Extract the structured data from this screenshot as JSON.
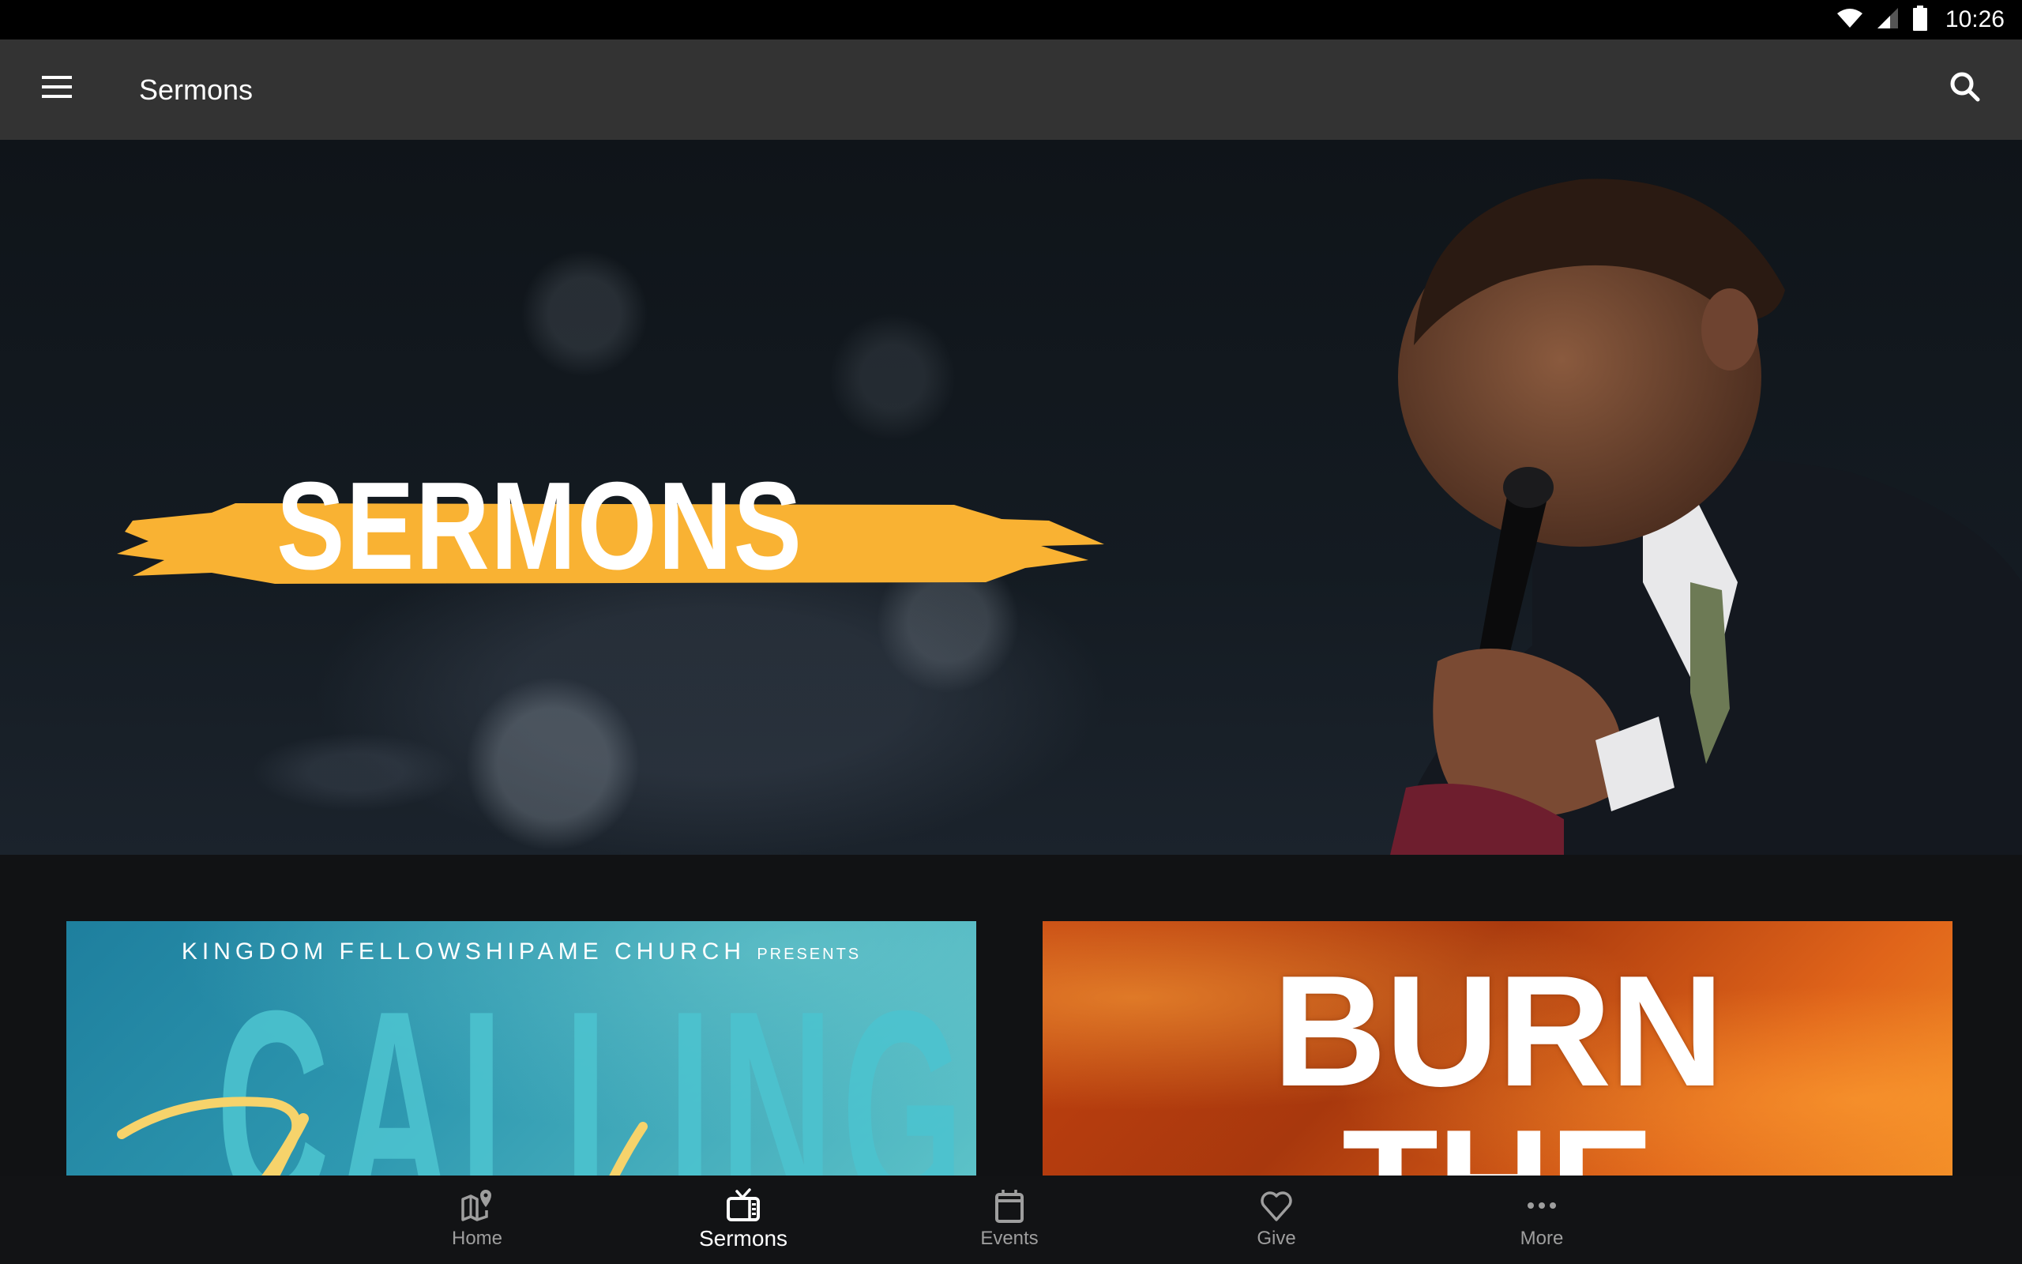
{
  "status_bar": {
    "time": "10:26",
    "icons": [
      "wifi-icon",
      "signal-icon",
      "battery-icon"
    ]
  },
  "app_bar": {
    "title": "Sermons",
    "menu_icon": "hamburger-menu-icon",
    "search_icon": "search-icon"
  },
  "hero": {
    "title": "SERMONS",
    "accent_color": "#F9B233"
  },
  "cards": [
    {
      "presenter": "KINGDOM FELLOWSHIPAME CHURCH",
      "presents": "PRESENTS",
      "title": "CALLING",
      "script_text": "You"
    },
    {
      "title_line1": "BURN",
      "title_line2": "THE"
    }
  ],
  "bottom_nav": {
    "items": [
      {
        "label": "Home",
        "icon": "map-pin-icon",
        "active": false
      },
      {
        "label": "Sermons",
        "icon": "tv-icon",
        "active": true
      },
      {
        "label": "Events",
        "icon": "calendar-icon",
        "active": false
      },
      {
        "label": "Give",
        "icon": "heart-icon",
        "active": false
      },
      {
        "label": "More",
        "icon": "more-dots-icon",
        "active": false
      }
    ],
    "active_color": "#FFFFFF",
    "inactive_color": "#9E9E9E"
  }
}
